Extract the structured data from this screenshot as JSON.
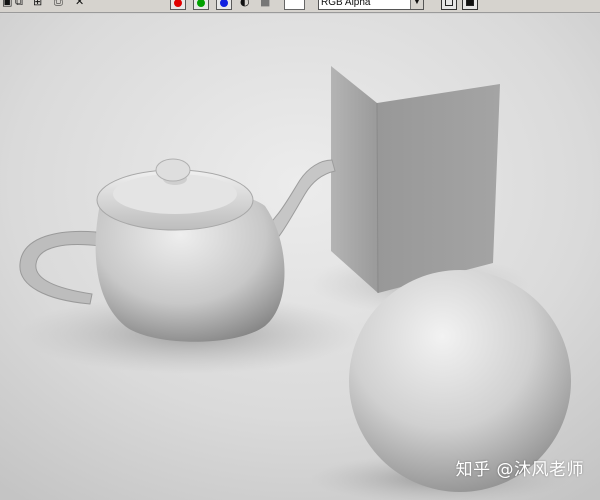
{
  "toolbar": {
    "channel_display": "RGB Alpha",
    "channel_buttons": [
      {
        "name": "red",
        "color": "#e00000"
      },
      {
        "name": "green",
        "color": "#00a000"
      },
      {
        "name": "blue",
        "color": "#1020e0"
      }
    ],
    "tool_icons": [
      "save-icon",
      "clone-icon",
      "copy-icon",
      "print-icon",
      "clear-icon"
    ],
    "swatch_color": "#ffffff"
  },
  "render": {
    "background_color": "#d9d9d9",
    "objects": [
      "teapot",
      "box",
      "sphere"
    ]
  },
  "watermark": {
    "text": "知乎 @沐风老师"
  }
}
